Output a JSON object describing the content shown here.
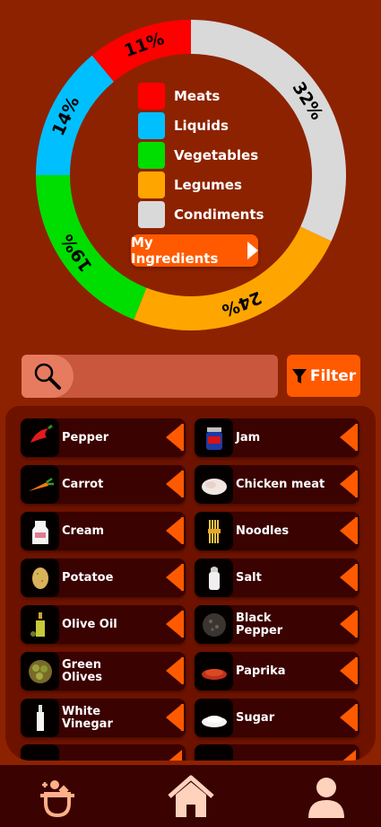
{
  "chart_data": {
    "type": "pie",
    "variant": "donut",
    "slices": [
      {
        "label": "Condiments",
        "value": 32,
        "label_text": "32%",
        "color": "#d9d9d9"
      },
      {
        "label": "Legumes",
        "value": 24,
        "label_text": "24%",
        "color": "#ffa500"
      },
      {
        "label": "Vegetables",
        "value": 19,
        "label_text": "19%",
        "color": "#00dd00"
      },
      {
        "label": "Liquids",
        "value": 14,
        "label_text": "14%",
        "color": "#00bfff"
      },
      {
        "label": "Meats",
        "value": 11,
        "label_text": "11%",
        "color": "#ff0000"
      }
    ],
    "legend": [
      {
        "label": "Meats",
        "color": "#ff0000"
      },
      {
        "label": "Liquids",
        "color": "#00bfff"
      },
      {
        "label": "Vegetables",
        "color": "#00dd00"
      },
      {
        "label": "Legumes",
        "color": "#ffa500"
      },
      {
        "label": "Condiments",
        "color": "#d9d9d9"
      }
    ],
    "legend_placement": "center"
  },
  "my_ingredients_label": "My Ingredients",
  "search": {
    "placeholder": "",
    "value": ""
  },
  "filter_label": "Filter",
  "ingredients": [
    {
      "name": "Pepper",
      "icon": "chili-pepper-icon"
    },
    {
      "name": "Jam",
      "icon": "jam-jar-icon"
    },
    {
      "name": "Carrot",
      "icon": "carrot-icon"
    },
    {
      "name": "Chicken meat",
      "icon": "chicken-meat-icon"
    },
    {
      "name": "Cream",
      "icon": "cream-carton-icon"
    },
    {
      "name": "Noodles",
      "icon": "noodles-icon"
    },
    {
      "name": "Potatoe",
      "icon": "potato-icon"
    },
    {
      "name": "Salt",
      "icon": "salt-shaker-icon"
    },
    {
      "name": "Olive Oil",
      "icon": "olive-oil-icon"
    },
    {
      "name": "Black\nPepper",
      "icon": "black-pepper-icon"
    },
    {
      "name": "Green\nOlives",
      "icon": "olives-icon"
    },
    {
      "name": "Paprika",
      "icon": "paprika-icon"
    },
    {
      "name": "White\nVinegar",
      "icon": "vinegar-bottle-icon"
    },
    {
      "name": "Sugar",
      "icon": "sugar-icon"
    }
  ],
  "colors": {
    "background": "#8d2200",
    "accent": "#ff5a00",
    "item_bg": "#3a0200",
    "nav_icon": "#ffd2bd"
  },
  "nav": [
    {
      "name": "ingredients-basket-icon"
    },
    {
      "name": "home-icon"
    },
    {
      "name": "profile-icon"
    }
  ]
}
